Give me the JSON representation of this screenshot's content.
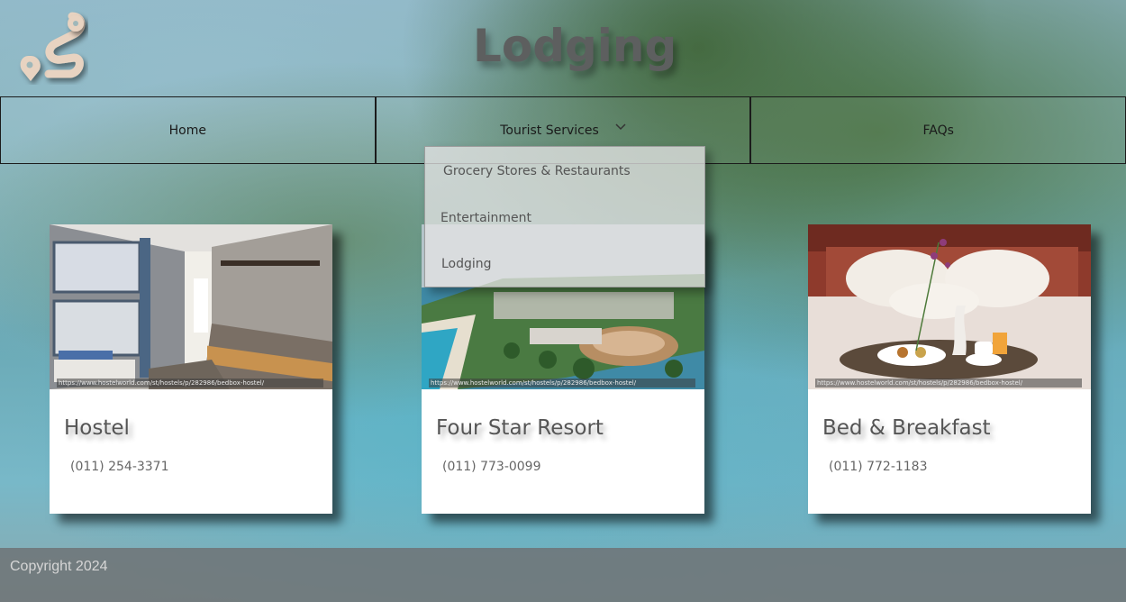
{
  "header": {
    "title": "Lodging",
    "logo_icon": "map-pin-route-icon"
  },
  "nav": {
    "items": [
      {
        "label": "Home"
      },
      {
        "label": "Tourist Services",
        "has_dropdown": true
      },
      {
        "label": "FAQs"
      }
    ]
  },
  "dropdown": {
    "items": [
      {
        "label": "Grocery Stores & Restaurants"
      },
      {
        "label": "Entertainment"
      },
      {
        "label": "Lodging"
      }
    ]
  },
  "cards": [
    {
      "title": "Hostel",
      "phone": "(011) 254-3371",
      "image_credit": "https://www.hostelworld.com/st/hostels/p/282986/bedbox-hostel/"
    },
    {
      "title": "Four Star Resort",
      "phone": "(011) 773-0099",
      "image_credit": "https://www.hostelworld.com/st/hostels/p/282986/bedbox-hostel/"
    },
    {
      "title": "Bed & Breakfast",
      "phone": "(011) 772-1183",
      "image_credit": "https://www.hostelworld.com/st/hostels/p/282986/bedbox-hostel/"
    }
  ],
  "footer": {
    "copyright": "Copyright 2024"
  },
  "colors": {
    "title": "#5d5f5f",
    "logo": "#e7d3c2",
    "footer": "#6e7376"
  }
}
